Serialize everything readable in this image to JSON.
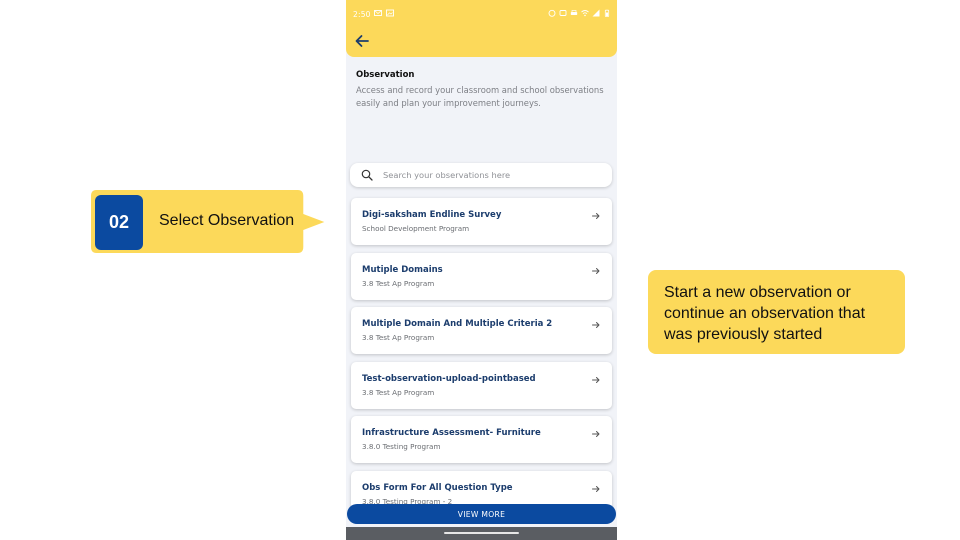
{
  "status_bar": {
    "time": "2:50"
  },
  "intro": {
    "title": "Observation",
    "description": "Access and record your classroom and school observations easily and plan your improvement journeys."
  },
  "search": {
    "placeholder": "Search your observations here"
  },
  "observations": [
    {
      "title": "Digi-saksham Endline Survey",
      "program": "School Development Program"
    },
    {
      "title": "Mutiple Domains",
      "program": "3.8 Test Ap Program"
    },
    {
      "title": "Multiple Domain And Multiple Criteria 2",
      "program": "3.8 Test Ap Program"
    },
    {
      "title": "Test-observation-upload-pointbased",
      "program": "3.8 Test Ap Program"
    },
    {
      "title": "Infrastructure Assessment- Furniture",
      "program": "3.8.0 Testing Program"
    },
    {
      "title": "Obs Form For All Question Type",
      "program": "3.8.0 Testing Program - 2"
    }
  ],
  "view_more_label": "VIEW MORE",
  "callouts": {
    "step_number": "02",
    "step_label": "Select Observation",
    "note": "Start a new observation or continue an observation that was previously started"
  },
  "colors": {
    "accent_yellow": "#fcd95a",
    "primary_blue": "#0b4aa0",
    "card_title": "#1c3d6d"
  }
}
